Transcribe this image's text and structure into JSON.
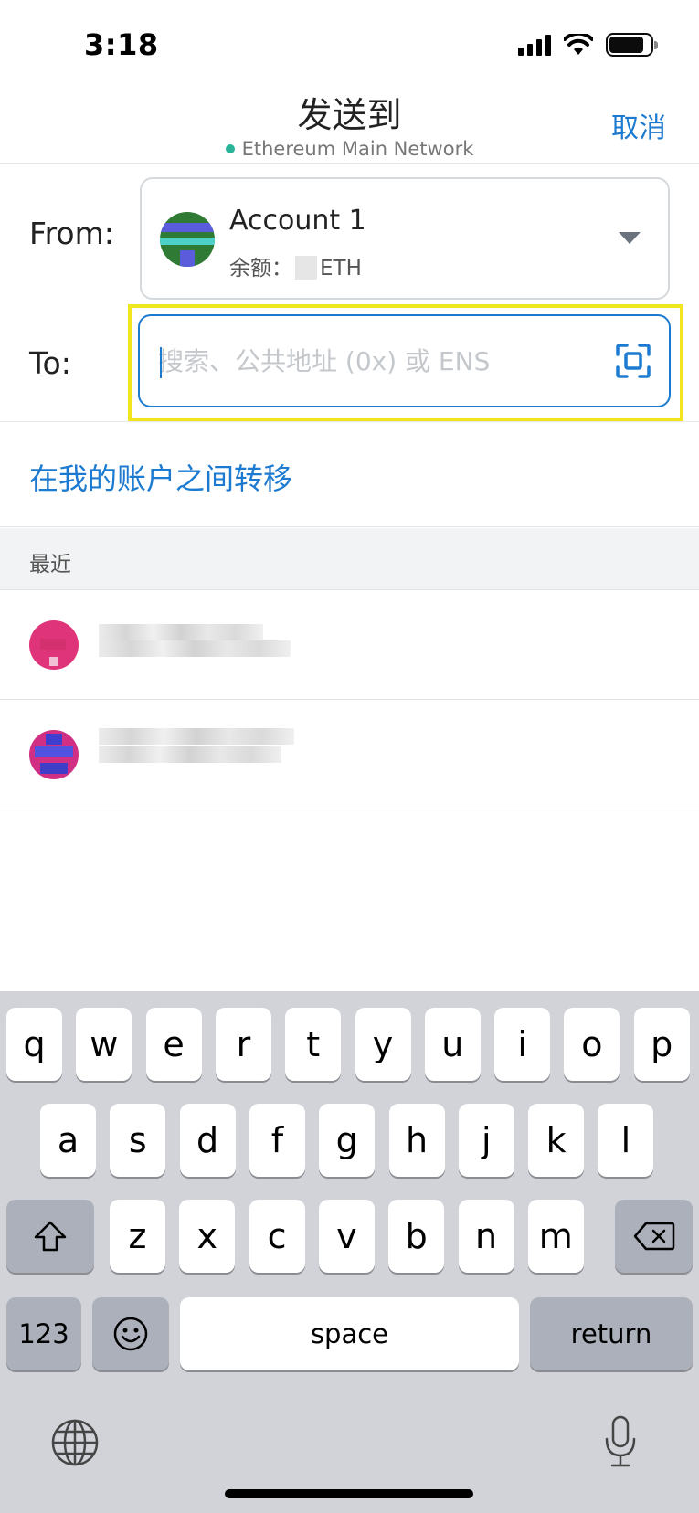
{
  "status_bar": {
    "time": "3:18"
  },
  "nav": {
    "title": "发送到",
    "network": "Ethereum Main Network",
    "cancel_label": "取消"
  },
  "from": {
    "label": "From:",
    "account_name": "Account 1",
    "balance_prefix": "余额：",
    "balance_unit": "ETH"
  },
  "to": {
    "label": "To:",
    "placeholder": "搜索、公共地址 (0x) 或 ENS"
  },
  "transfer_link": "在我的账户之间转移",
  "recent": {
    "header": "最近"
  },
  "keyboard": {
    "row1": [
      "q",
      "w",
      "e",
      "r",
      "t",
      "y",
      "u",
      "i",
      "o",
      "p"
    ],
    "row2": [
      "a",
      "s",
      "d",
      "f",
      "g",
      "h",
      "j",
      "k",
      "l"
    ],
    "row3": [
      "z",
      "x",
      "c",
      "v",
      "b",
      "n",
      "m"
    ],
    "numbers_label": "123",
    "space_label": "space",
    "return_label": "return"
  },
  "colors": {
    "accent": "#1c7bd0",
    "highlight": "#f0e51e",
    "network_dot": "#2bb39a"
  }
}
